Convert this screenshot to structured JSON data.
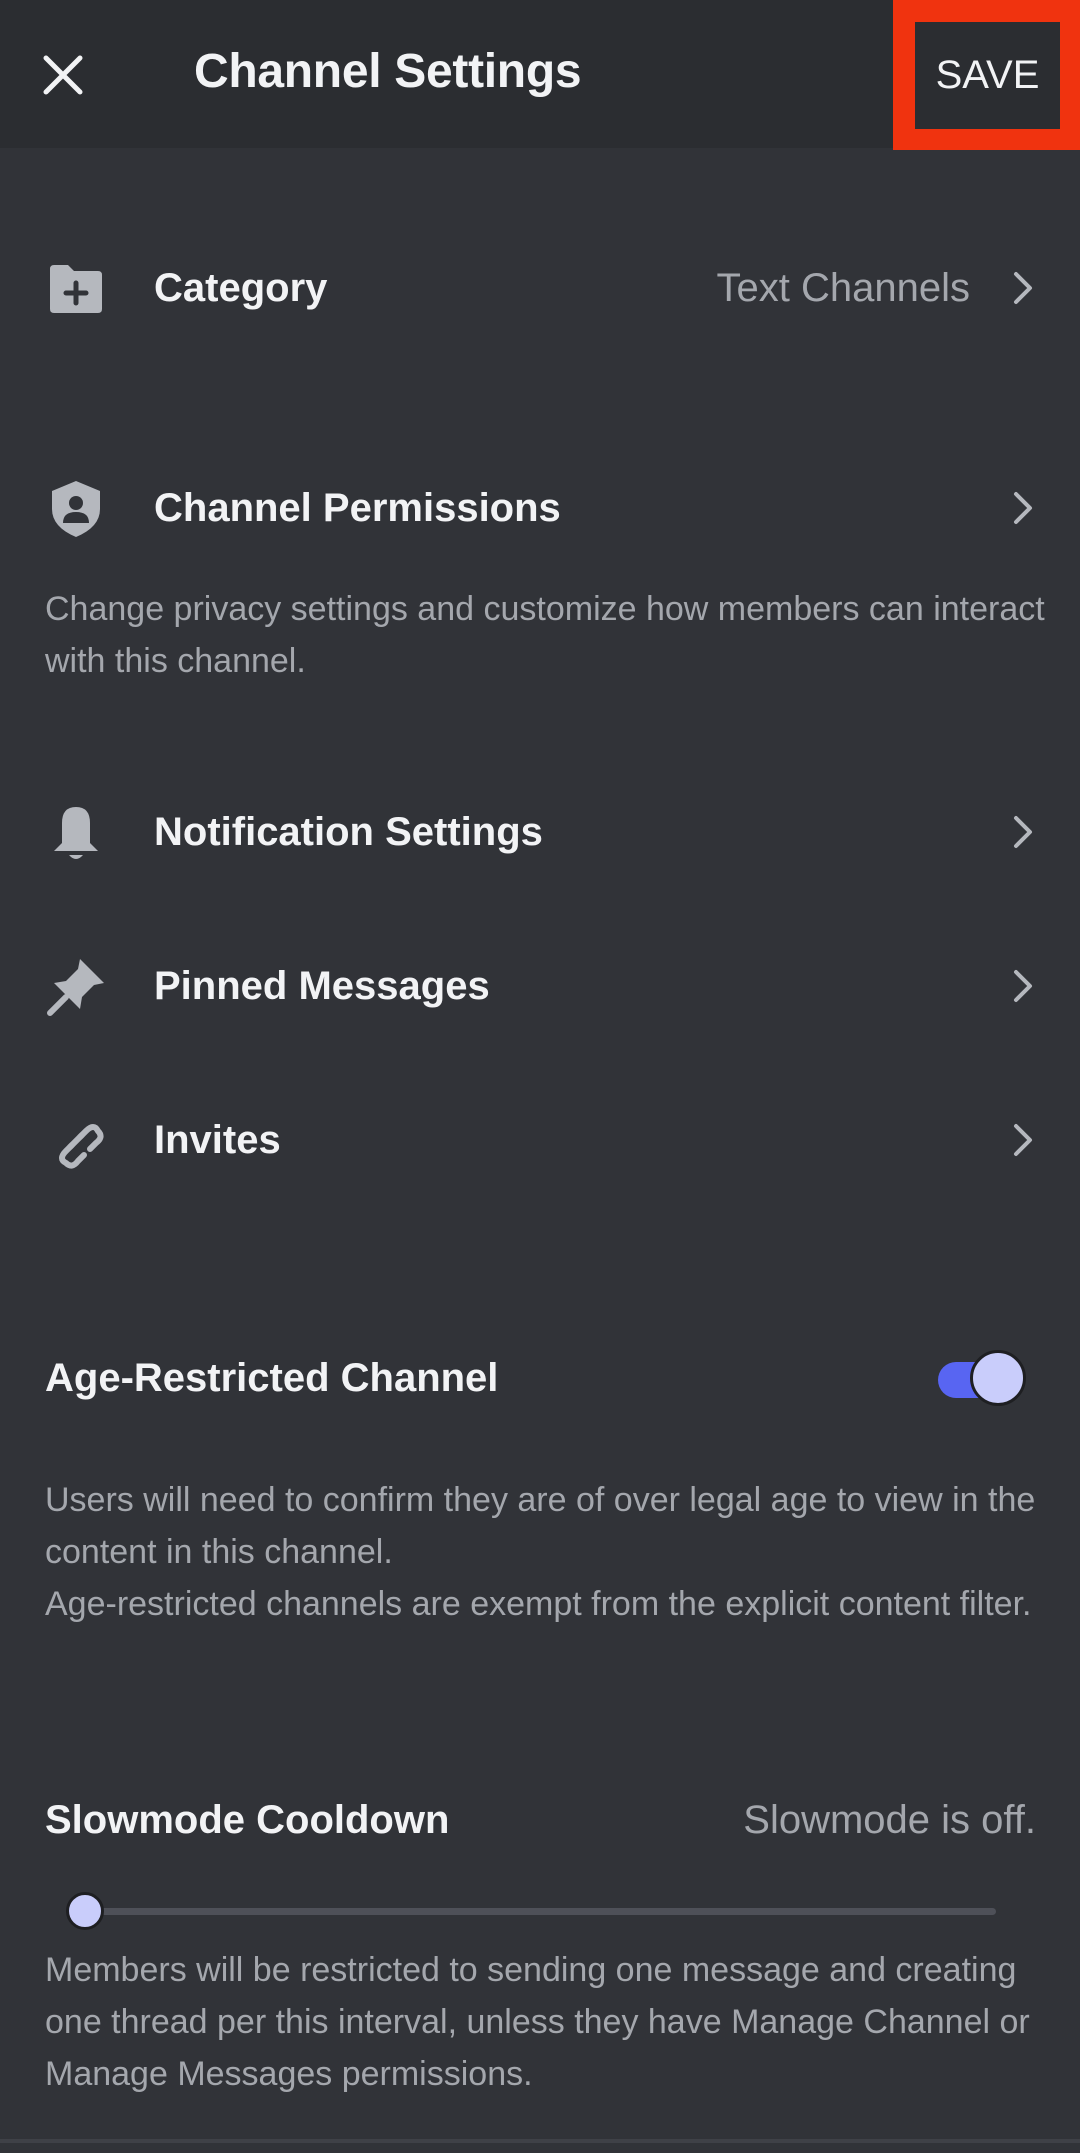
{
  "header": {
    "title": "Channel Settings",
    "close_icon": "close-icon",
    "save_label": "SAVE",
    "save_highlight_color": "#f0330f"
  },
  "rows": [
    {
      "id": "category",
      "icon": "folder-plus-icon",
      "label": "Category",
      "value": "Text Channels"
    },
    {
      "id": "channel-permissions",
      "icon": "shield-user-icon",
      "label": "Channel Permissions",
      "value": ""
    },
    {
      "id": "notification-settings",
      "icon": "bell-icon",
      "label": "Notification Settings",
      "value": ""
    },
    {
      "id": "pinned-messages",
      "icon": "pin-icon",
      "label": "Pinned Messages",
      "value": ""
    },
    {
      "id": "invites",
      "icon": "link-icon",
      "label": "Invites",
      "value": ""
    }
  ],
  "permissions_description": "Change privacy settings and customize how members can interact with this channel.",
  "age_restricted": {
    "title": "Age-Restricted Channel",
    "enabled": true,
    "description_line1": "Users will need to confirm they are of over legal age to view in the content in this channel.",
    "description_line2": "Age-restricted channels are exempt from the explicit content filter."
  },
  "slowmode": {
    "title": "Slowmode Cooldown",
    "status": "Slowmode is off.",
    "slider_value_fraction": 0,
    "description": "Members will be restricted to sending one message and creating one thread per this interval, unless they have Manage Channel or Manage Messages permissions."
  },
  "colors": {
    "background": "#313338",
    "header_background": "#2b2d31",
    "accent": "#5865f2",
    "knob": "#c9cdfb",
    "text_primary": "#f2f3f5",
    "text_muted": "#a4a7ad"
  }
}
